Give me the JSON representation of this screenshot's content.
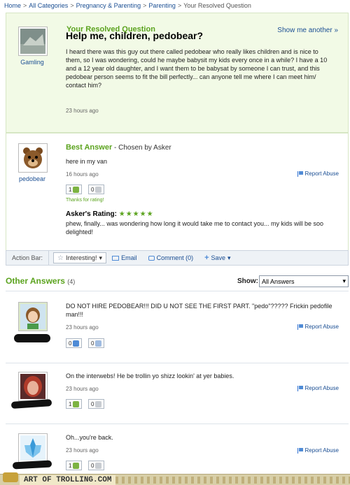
{
  "breadcrumb": {
    "items": [
      "Home",
      "All Categories",
      "Pregnancy & Parenting",
      "Parenting"
    ],
    "current": "Your Resolved Question",
    "separator": ">"
  },
  "question": {
    "header": "Your Resolved Question",
    "show_another": "Show me another »",
    "asker_name": "Gamling",
    "title": "Help me, children, pedobear?",
    "body": "I heard there was this guy out there called pedobear who really likes children and is nice to them, so I was wondering, could he maybe babysit my kids every once in a while? I have a 10 and a 12 year old daughter, and I want them to be babysat by someone I can trust, and this pedobear person seems to fit the bill perfectly... can anyone tell me where I can meet him/ contact him?",
    "time": "23 hours ago"
  },
  "best_answer": {
    "header": "Best Answer",
    "chosen": " - Chosen by Asker",
    "user_name": "pedobear",
    "text": "here in my van",
    "time": "16 hours ago",
    "report": "Report Abuse",
    "votes_up": "1",
    "votes_down": "0",
    "thanks": "Thanks for rating!",
    "rating_label": "Asker's Rating:",
    "rating_stars": "★★★★★",
    "rating_comment": "phew, finally... was wondering how long it would take me to contact you... my kids will be soo delighted!"
  },
  "action_bar": {
    "label": "Action Bar:",
    "interesting": "Interesting!",
    "email": "Email",
    "comment": "Comment (0)",
    "save": "Save"
  },
  "other_answers": {
    "title": "Other Answers",
    "count": "(4)",
    "show_label": "Show:",
    "show_value": "All Answers",
    "items": [
      {
        "text": "DO NOT HIRE PEDOBEAR!!! DID U NOT SEE THE FIRST PART. \"pedo\"????? Frickin pedofile man!!!",
        "time": "23 hours ago",
        "report": "Report Abuse",
        "up": "0",
        "down": "0"
      },
      {
        "text": "On the interwebs! He be trollin yo shizz lookin' at yer babies.",
        "time": "23 hours ago",
        "report": "Report Abuse",
        "up": "1",
        "down": "0"
      },
      {
        "text": "Oh...you're back.",
        "time": "23 hours ago",
        "report": "Report Abuse",
        "up": "1",
        "down": "0"
      }
    ]
  },
  "footer": {
    "logo": "ART OF TROLLING.COM"
  },
  "colors": {
    "green": "#5ba31e",
    "link_blue": "#1a4e93",
    "question_bg": "#f2fae6"
  }
}
